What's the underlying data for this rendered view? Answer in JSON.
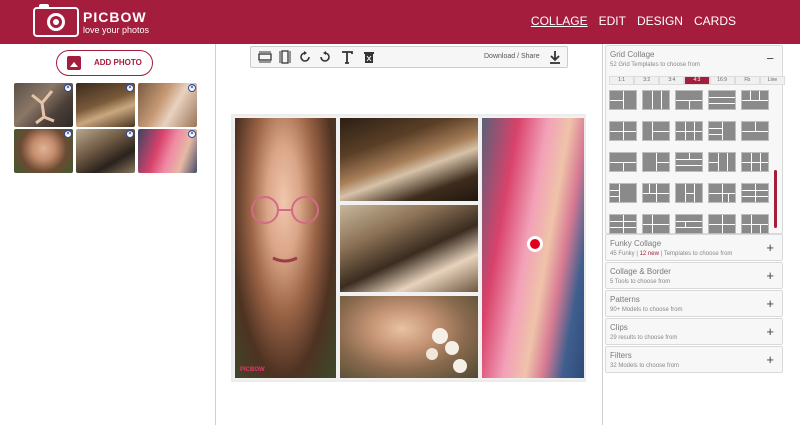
{
  "header": {
    "brand": "PICBOW",
    "tagline": "love your photos",
    "nav": [
      "COLLAGE",
      "EDIT",
      "DESIGN",
      "CARDS"
    ],
    "active_nav": "COLLAGE"
  },
  "left": {
    "add_photo_label": "ADD PHOTO",
    "thumbnails": [
      {
        "name": "dancer-photo"
      },
      {
        "name": "reclining-hat-photo"
      },
      {
        "name": "flowers-photo"
      },
      {
        "name": "glasses-portrait-photo"
      },
      {
        "name": "lying-hat-photo"
      },
      {
        "name": "pink-hair-photo"
      }
    ]
  },
  "toolbar": {
    "download_label": "Download / Share",
    "icons": [
      "fit-width-icon",
      "fit-height-icon",
      "rotate-right-icon",
      "rotate-left-icon",
      "text-icon",
      "delete-icon",
      "download-icon"
    ]
  },
  "collage": {
    "watermark": "PICBOW"
  },
  "right": {
    "grid_collage": {
      "title": "Grid Collage",
      "subtitle": "52 Grid Templates to choose from",
      "toggle": "−"
    },
    "ratios": [
      "1:1",
      "3:2",
      "3:4",
      "4:3",
      "16:9",
      "Fb",
      "Line"
    ],
    "active_ratio": "4:3",
    "sections": [
      {
        "title": "Funky Collage",
        "subtitle_pre": "45 Funky | ",
        "subtitle_new": "12 new",
        "subtitle_post": " | Templates to choose from",
        "toggle": "+"
      },
      {
        "title": "Collage & Border",
        "subtitle": "5 Tools to choose from",
        "toggle": "+"
      },
      {
        "title": "Patterns",
        "subtitle": "90+ Models to choose from",
        "toggle": "+"
      },
      {
        "title": "Clips",
        "subtitle": "29 results to choose from",
        "toggle": "+"
      },
      {
        "title": "Filters",
        "subtitle": "32 Models to choose from",
        "toggle": "+"
      }
    ]
  },
  "colors": {
    "brand": "#a51d3c",
    "handle": "#e2001a"
  }
}
